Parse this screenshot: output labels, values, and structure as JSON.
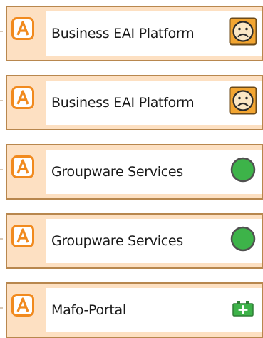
{
  "items": [
    {
      "label": "Business EAI Platform",
      "type_icon": "application-a-icon",
      "status_icon": "sad-face-icon",
      "status_color": "#f2a531"
    },
    {
      "label": "Business EAI Platform",
      "type_icon": "application-a-icon",
      "status_icon": "sad-face-icon",
      "status_color": "#f2a531"
    },
    {
      "label": "Groupware Services",
      "type_icon": "application-a-icon",
      "status_icon": "green-circle-icon",
      "status_color": "#3db349"
    },
    {
      "label": "Groupware Services",
      "type_icon": "application-a-icon",
      "status_icon": "green-circle-icon",
      "status_color": "#3db349"
    },
    {
      "label": "Mafo-Portal",
      "type_icon": "application-a-icon",
      "status_icon": "battery-plus-icon",
      "status_color": "#3db349"
    }
  ],
  "colors": {
    "card_border": "#b8874e",
    "card_fill": "#fde0c2",
    "icon_orange": "#f18a1e"
  }
}
